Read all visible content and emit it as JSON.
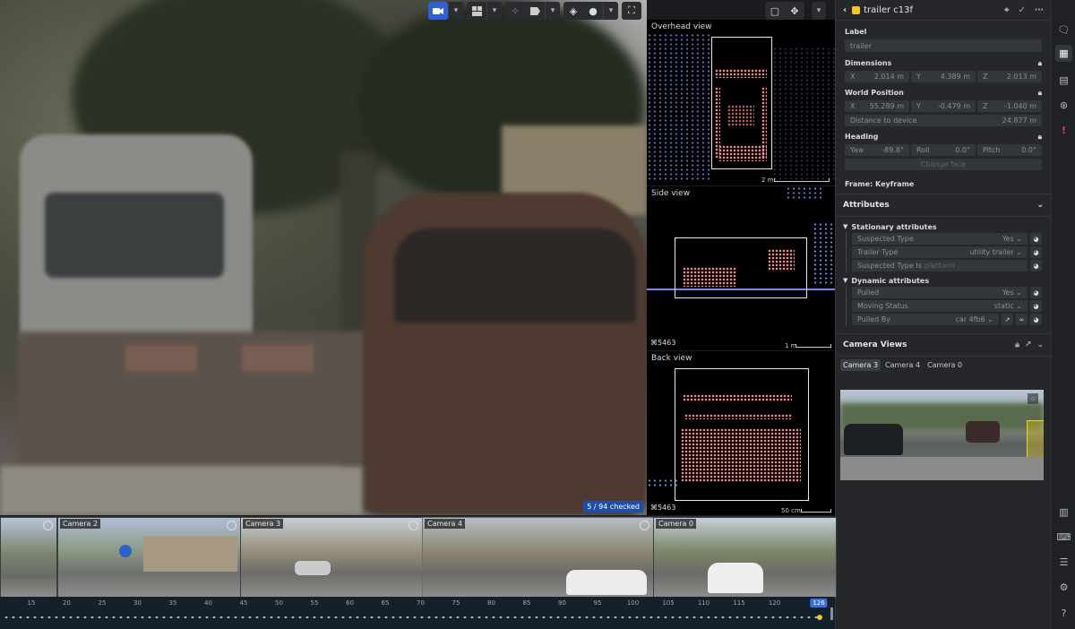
{
  "main_view": {
    "checked_badge": "5 / 94 checked"
  },
  "toolbar": {
    "left_icons": [
      "camera-icon",
      "layout-icon",
      "points-icon",
      "label-icon",
      "layers-icon",
      "circle-icon",
      "fullscreen-icon"
    ],
    "right_icons": [
      "frame-icon",
      "move-icon"
    ]
  },
  "point_cloud": {
    "overhead": {
      "title": "Overhead view",
      "scale": "2 m"
    },
    "side": {
      "title": "Side view",
      "scale": "1 m",
      "point_count": "5463"
    },
    "back": {
      "title": "Back view",
      "scale": "50 cm",
      "point_count": "5463"
    }
  },
  "panel": {
    "object_title": "trailer c13f",
    "object_color": "#f2c523",
    "label_section": "Label",
    "label_value": "trailer",
    "dimensions_section": "Dimensions",
    "dimensions": [
      {
        "axis": "X",
        "value": "2.014 m"
      },
      {
        "axis": "Y",
        "value": "4.389 m"
      },
      {
        "axis": "Z",
        "value": "2.013 m"
      }
    ],
    "world_position_section": "World Position",
    "world_position": [
      {
        "axis": "X",
        "value": "55.289 m"
      },
      {
        "axis": "Y",
        "value": "-0.479 m"
      },
      {
        "axis": "Z",
        "value": "-1.040 m"
      }
    ],
    "distance_label": "Distance to device",
    "distance_value": "24.877 m",
    "heading_section": "Heading",
    "heading": [
      {
        "axis": "Yaw",
        "value": "-89.8°"
      },
      {
        "axis": "Roll",
        "value": "0.0°"
      },
      {
        "axis": "Pitch",
        "value": "0.0°"
      }
    ],
    "change_face": "Change face",
    "frame_label": "Frame: Keyframe",
    "attributes_section": "Attributes",
    "stationary_title": "Stationary attributes",
    "stationary": [
      {
        "name": "Suspected Type",
        "value": "Yes"
      },
      {
        "name": "Trailer Type",
        "value": "utility trailer"
      },
      {
        "name": "Suspected Type Is",
        "value": "platform"
      }
    ],
    "dynamic_title": "Dynamic attributes",
    "dynamic": [
      {
        "name": "Pulled",
        "value": "Yes"
      },
      {
        "name": "Moving Status",
        "value": "static"
      },
      {
        "name": "Pulled By",
        "value": "car 4fb6"
      }
    ],
    "camera_views_section": "Camera Views",
    "camera_tabs": [
      "Camera 3",
      "Camera 4",
      "Camera 0"
    ],
    "active_camera_tab": "Camera 3"
  },
  "filmstrip": {
    "cameras": [
      "Camera 2",
      "Camera 3",
      "Camera 4",
      "Camera 0"
    ]
  },
  "timeline": {
    "ticks": [
      "15",
      "20",
      "25",
      "30",
      "35",
      "40",
      "45",
      "50",
      "55",
      "60",
      "65",
      "70",
      "75",
      "80",
      "85",
      "90",
      "95",
      "100",
      "105",
      "110",
      "115",
      "120",
      "126"
    ],
    "current": "126"
  }
}
